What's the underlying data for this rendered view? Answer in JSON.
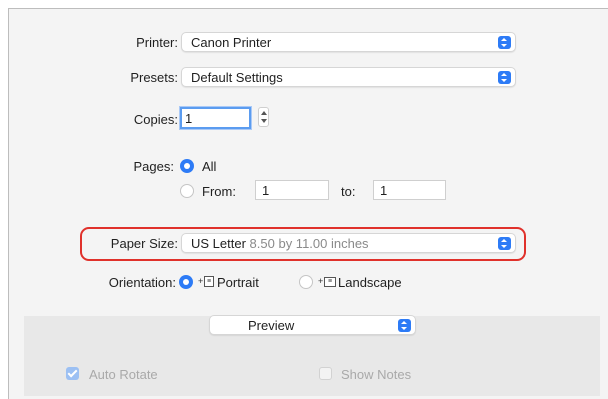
{
  "printer": {
    "label": "Printer:",
    "value": "Canon Printer"
  },
  "presets": {
    "label": "Presets:",
    "value": "Default Settings"
  },
  "copies": {
    "label": "Copies:",
    "value": "1"
  },
  "pages": {
    "label": "Pages:",
    "all_label": "All",
    "from_label": "From:",
    "from_value": "1",
    "to_label": "to:",
    "to_value": "1",
    "selected": "All"
  },
  "paper_size": {
    "label": "Paper Size:",
    "value": "US Letter",
    "detail": "8.50 by 11.00 inches"
  },
  "orientation": {
    "label": "Orientation:",
    "portrait": "Portrait",
    "landscape": "Landscape",
    "selected": "Portrait"
  },
  "section": {
    "value": "Preview"
  },
  "options": {
    "auto_rotate": {
      "label": "Auto Rotate",
      "checked": true
    },
    "show_notes": {
      "label": "Show Notes",
      "checked": false
    }
  },
  "colors": {
    "accent": "#2d7bf6",
    "highlight": "#e0312b"
  }
}
